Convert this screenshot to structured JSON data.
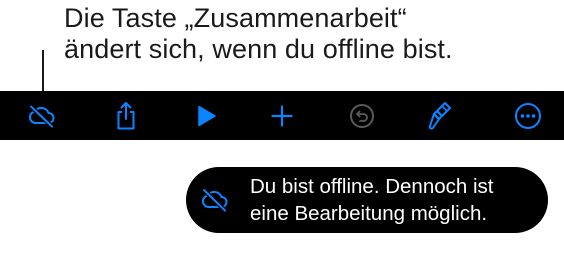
{
  "callout": {
    "line1": "Die Taste „Zusammenarbeit“",
    "line2": "ändert sich, wenn du offline bist."
  },
  "toolbar": {
    "background": "#000000",
    "accent": "#0a84ff",
    "disabled": "#5a5a5a",
    "buttons": [
      {
        "icon": "cloud-offline-icon",
        "state": "active"
      },
      {
        "icon": "share-icon",
        "state": "active"
      },
      {
        "icon": "play-icon",
        "state": "active"
      },
      {
        "icon": "plus-icon",
        "state": "active"
      },
      {
        "icon": "undo-icon",
        "state": "disabled"
      },
      {
        "icon": "paintbrush-icon",
        "state": "active"
      },
      {
        "icon": "more-icon",
        "state": "active"
      }
    ]
  },
  "toast": {
    "icon": "cloud-offline-icon",
    "line1": "Du bist offline. Dennoch ist",
    "line2": "eine Bearbeitung möglich."
  }
}
